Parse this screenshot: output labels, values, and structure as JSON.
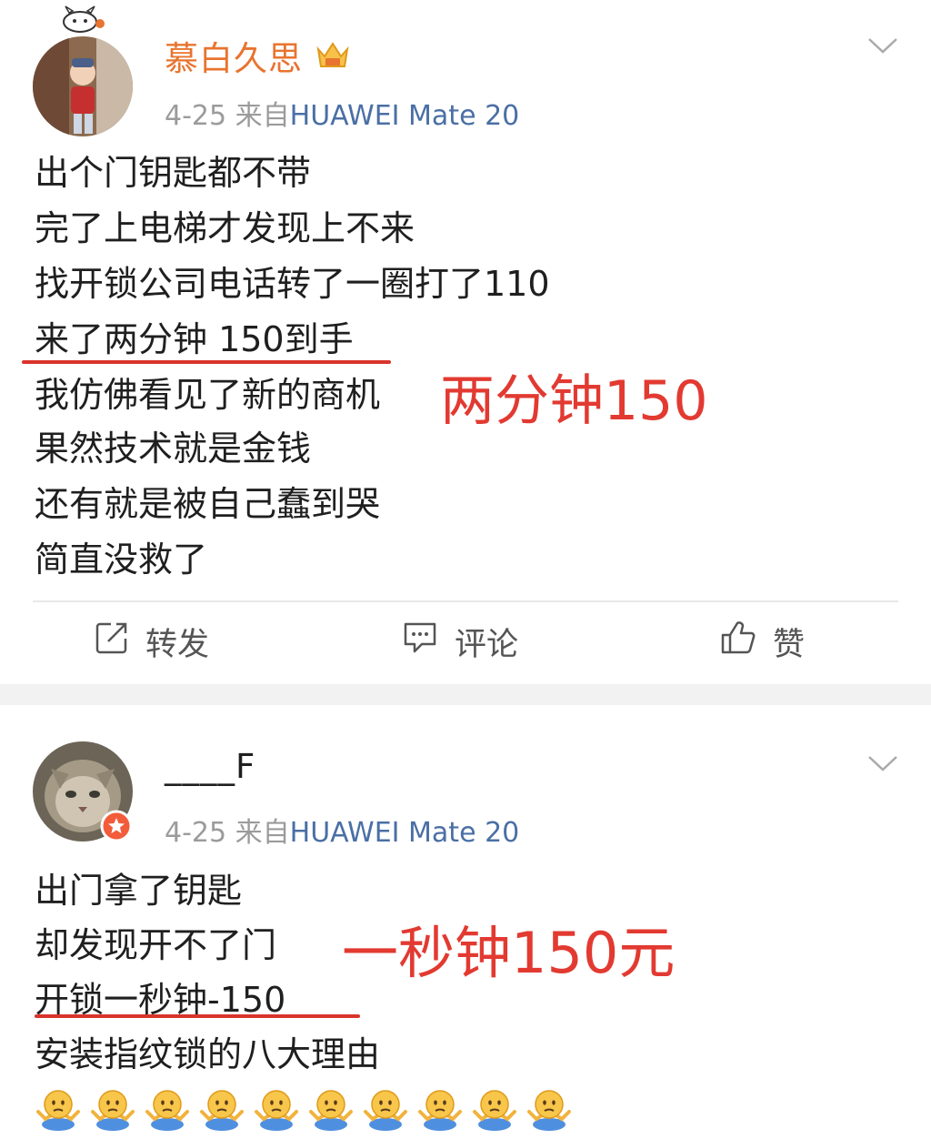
{
  "post1": {
    "username": "慕白久思",
    "date": "4-25",
    "source_prefix": "来自",
    "device": "HUAWEI Mate 20",
    "lines": [
      "出个门钥匙都不带",
      "完了上电梯才发现上不来",
      "找开锁公司电话转了一圈打了110",
      "来了两分钟 150到手",
      "我仿佛看见了新的商机",
      "果然技术就是金钱",
      "还有就是被自己蠢到哭",
      "简直没救了"
    ],
    "annotation": "两分钟150",
    "actions": {
      "repost": "转发",
      "comment": "评论",
      "like": "赞"
    }
  },
  "post2": {
    "username": "____F",
    "date": "4-25",
    "source_prefix": "来自",
    "device": "HUAWEI Mate 20",
    "lines": [
      "出门拿了钥匙",
      "却发现开不了门",
      "开锁一秒钟-150",
      "安装指纹锁的八大理由"
    ],
    "annotation": "一秒钟150元",
    "emoji_count": 10,
    "emoji_icon": "shrug-emoji-icon"
  },
  "colors": {
    "username_orange": "#e8742f",
    "device_blue": "#4a6fa5",
    "annotation_red": "#e23a31"
  }
}
